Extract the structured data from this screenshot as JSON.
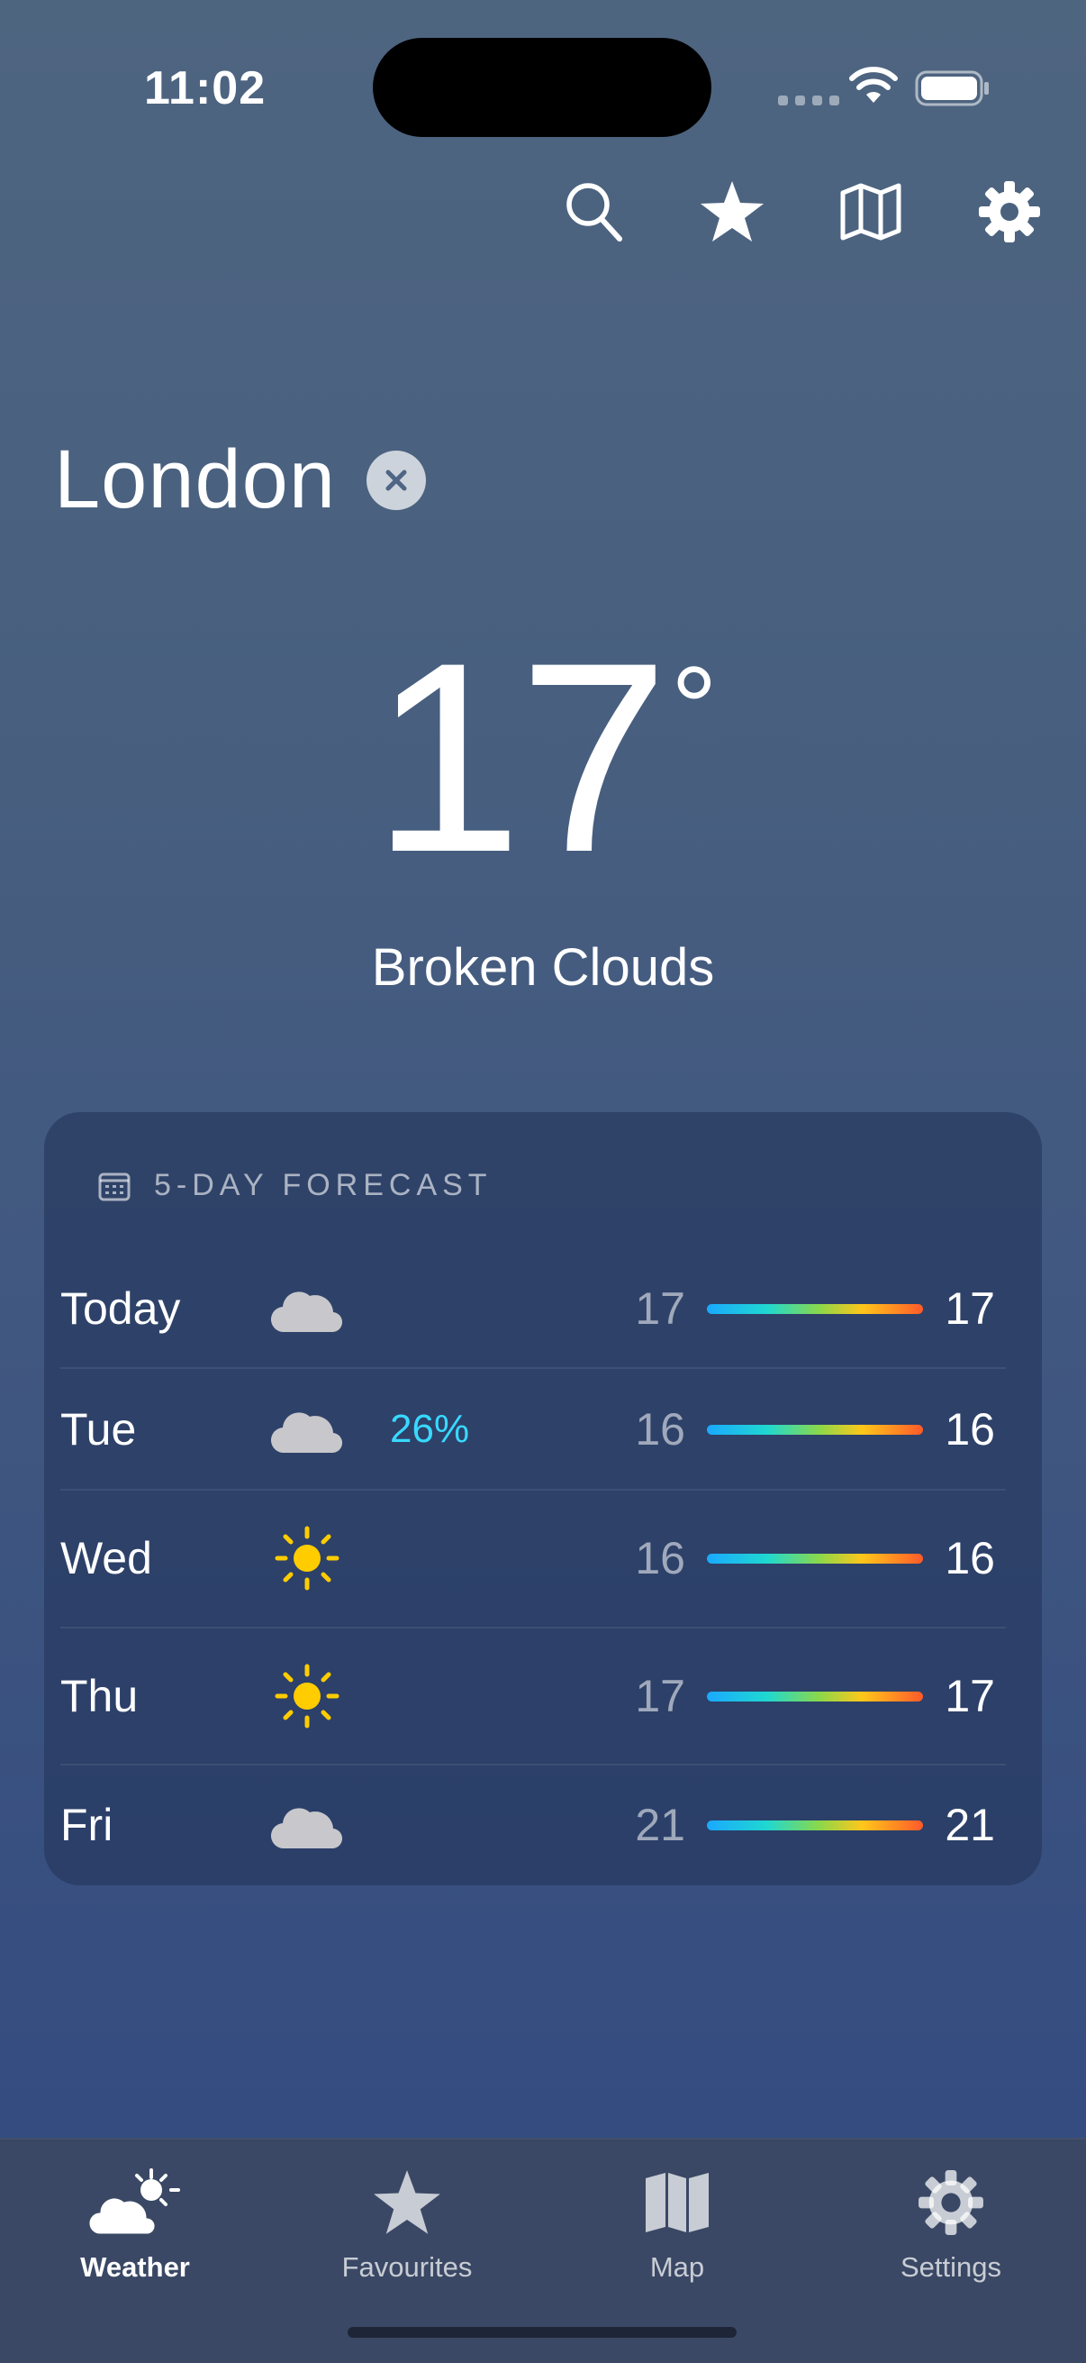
{
  "status_bar": {
    "time": "11:02"
  },
  "toolbar": {
    "icons": [
      "search-icon",
      "star-icon",
      "map-icon",
      "gear-icon"
    ]
  },
  "location": {
    "city": "London"
  },
  "current": {
    "temperature": "17",
    "degree": "°",
    "condition": "Broken Clouds"
  },
  "forecast": {
    "title": "5-DAY FORECAST",
    "days": [
      {
        "day": "Today",
        "icon": "cloud-icon",
        "precip": "",
        "low": "17",
        "high": "17"
      },
      {
        "day": "Tue",
        "icon": "cloud-icon",
        "precip": "26%",
        "low": "16",
        "high": "16"
      },
      {
        "day": "Wed",
        "icon": "sun-icon",
        "precip": "",
        "low": "16",
        "high": "16"
      },
      {
        "day": "Thu",
        "icon": "sun-icon",
        "precip": "",
        "low": "17",
        "high": "17"
      },
      {
        "day": "Fri",
        "icon": "cloud-icon",
        "precip": "",
        "low": "21",
        "high": "21"
      }
    ]
  },
  "tab_bar": {
    "tabs": [
      {
        "label": "Weather",
        "icon": "weather-icon",
        "active": true
      },
      {
        "label": "Favourites",
        "icon": "star-icon",
        "active": false
      },
      {
        "label": "Map",
        "icon": "map-icon",
        "active": false
      },
      {
        "label": "Settings",
        "icon": "gear-icon",
        "active": false
      }
    ]
  },
  "colors": {
    "precip": "#38d9ff",
    "sun": "#ffcc00",
    "cloud": "#c8c8cc"
  }
}
